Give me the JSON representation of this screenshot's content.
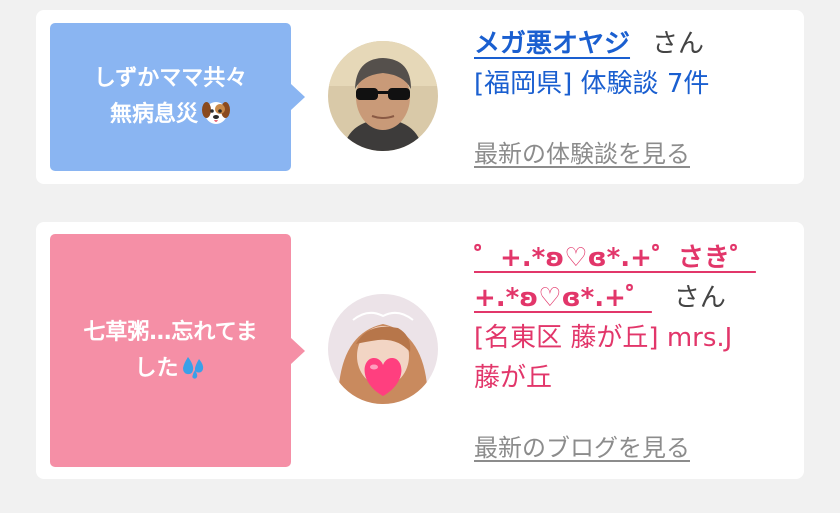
{
  "cards": [
    {
      "message_line1": "しずかママ共々",
      "message_line2": "無病息災",
      "message_emoji": "dog-face-emoji",
      "user_name": "メガ悪オヤジ",
      "honorific": "さん",
      "detail": "[福岡県] 体験談 7件",
      "more_link": "最新の体験談を見る",
      "accent": "#8ab5f2",
      "name_color": "#1a5fd0"
    },
    {
      "message_line1": "七草粥…忘れてま",
      "message_line2": "した",
      "message_emoji": "sweat-droplets-emoji",
      "user_name_line1": "゜+.*ʚ♡ɞ*.+゜さき゜",
      "user_name_line2": "+.*ʚ♡ɞ*.+゜",
      "honorific": "さん",
      "detail_line1": "[名東区 藤が丘] mrs.J",
      "detail_line2": "藤が丘",
      "more_link": "最新のブログを見る",
      "accent": "#f58fa6",
      "name_color": "#e2366a"
    }
  ]
}
